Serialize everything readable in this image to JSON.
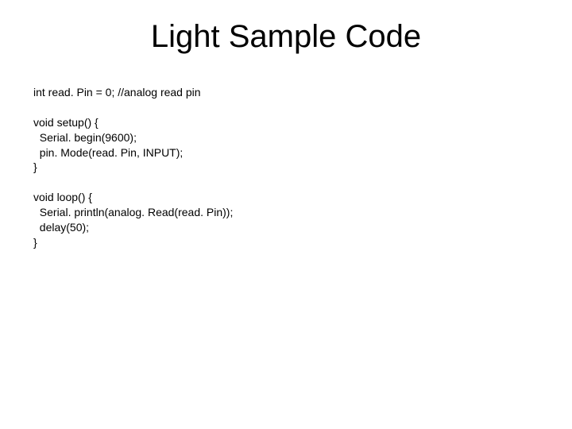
{
  "slide": {
    "title": "Light Sample Code",
    "code": "int read. Pin = 0; //analog read pin\n\nvoid setup() {\n  Serial. begin(9600);\n  pin. Mode(read. Pin, INPUT);\n}\n\nvoid loop() {\n  Serial. println(analog. Read(read. Pin));\n  delay(50);\n}"
  }
}
